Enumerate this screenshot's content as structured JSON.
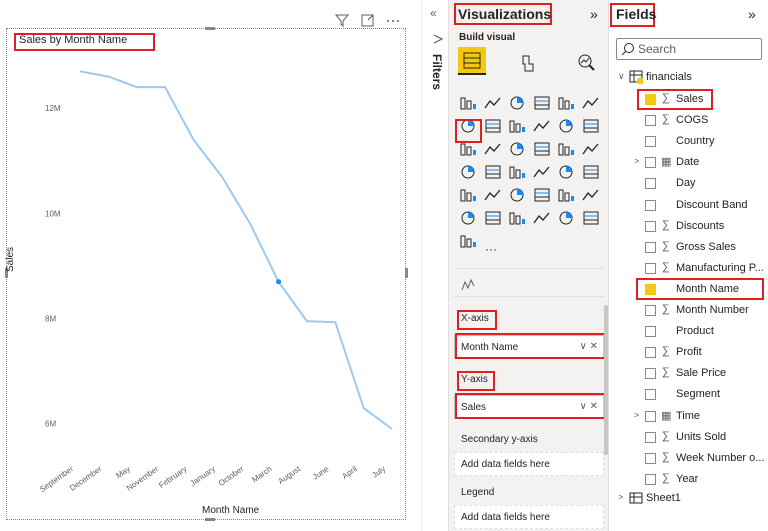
{
  "visual": {
    "title": "Sales by Month Name",
    "y_title": "Sales",
    "x_title": "Month Name"
  },
  "chart_data": {
    "type": "line",
    "categories": [
      "September",
      "December",
      "May",
      "November",
      "February",
      "January",
      "October",
      "March",
      "August",
      "June",
      "April",
      "July"
    ],
    "series": [
      {
        "values": [
          12.7,
          12.6,
          12.4,
          12.4,
          11.4,
          10.7,
          9.8,
          8.7,
          7.95,
          7.93,
          6.3,
          5.9
        ]
      }
    ],
    "y_tick_labels": [
      "6M",
      "8M",
      "10M",
      "12M"
    ],
    "y_ticks": [
      6,
      8,
      10,
      12
    ],
    "ylim": [
      5.5,
      13.2
    ],
    "line_color": "#9ccaf3",
    "highlight_index": 7
  },
  "filters": {
    "label": "Filters"
  },
  "visualizations": {
    "title": "Visualizations",
    "build_visual": "Build visual",
    "x_axis_label": "X-axis",
    "x_axis_value": "Month Name",
    "y_axis_label": "Y-axis",
    "y_axis_value": "Sales",
    "secondary_label": "Secondary y-axis",
    "secondary_placeholder": "Add data fields here",
    "legend_label": "Legend",
    "legend_placeholder": "Add data fields here",
    "more": "···",
    "accent": "#f2c811"
  },
  "fields": {
    "title": "Fields",
    "search_placeholder": "Search",
    "table_name": "financials",
    "items": [
      {
        "label": "Sales",
        "sigma": true,
        "checked": true
      },
      {
        "label": "COGS",
        "sigma": true,
        "checked": false
      },
      {
        "label": "Country",
        "sigma": false,
        "checked": false
      },
      {
        "label": "Date",
        "sigma": false,
        "checked": false,
        "expandable": true
      },
      {
        "label": "Day",
        "sigma": false,
        "checked": false
      },
      {
        "label": "Discount Band",
        "sigma": false,
        "checked": false
      },
      {
        "label": "Discounts",
        "sigma": true,
        "checked": false
      },
      {
        "label": "Gross Sales",
        "sigma": true,
        "checked": false
      },
      {
        "label": "Manufacturing P...",
        "sigma": true,
        "checked": false
      },
      {
        "label": "Month Name",
        "sigma": false,
        "checked": true
      },
      {
        "label": "Month Number",
        "sigma": true,
        "checked": false
      },
      {
        "label": "Product",
        "sigma": false,
        "checked": false
      },
      {
        "label": "Profit",
        "sigma": true,
        "checked": false
      },
      {
        "label": "Sale Price",
        "sigma": true,
        "checked": false
      },
      {
        "label": "Segment",
        "sigma": false,
        "checked": false
      },
      {
        "label": "Time",
        "sigma": false,
        "checked": false,
        "expandable": true
      },
      {
        "label": "Units Sold",
        "sigma": true,
        "checked": false
      },
      {
        "label": "Week Number o...",
        "sigma": true,
        "checked": false
      },
      {
        "label": "Year",
        "sigma": true,
        "checked": false
      }
    ],
    "sheet1": "Sheet1"
  }
}
